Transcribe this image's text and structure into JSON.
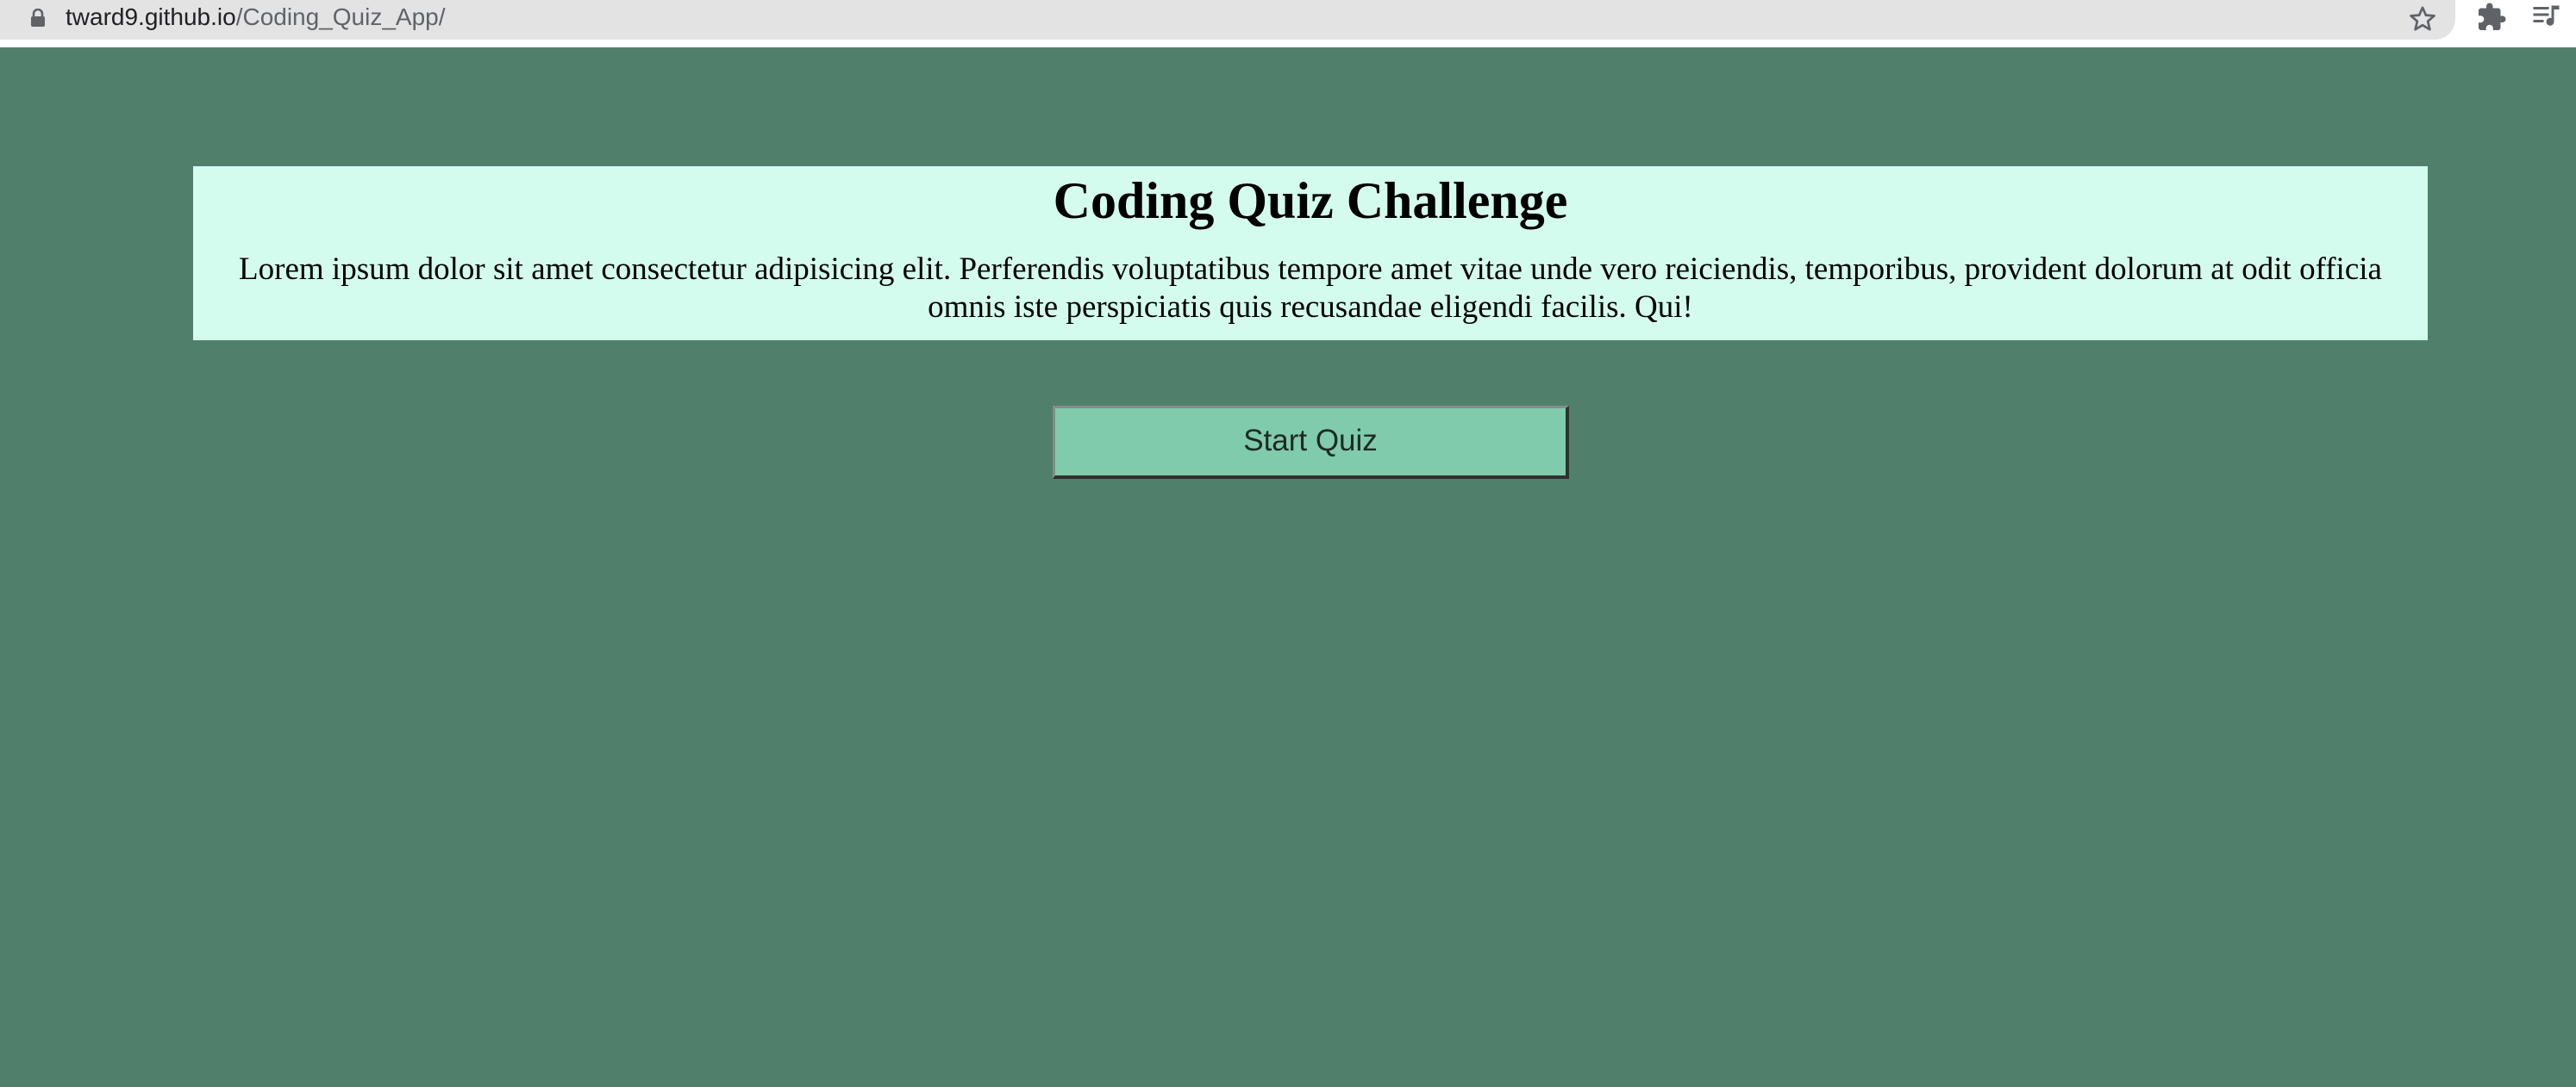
{
  "browser": {
    "url_host": "tward9.github.io",
    "url_path": "/Coding_Quiz_App/",
    "icons": [
      "lock-icon",
      "star-icon",
      "extensions-puzzle-icon",
      "media-control-icon"
    ]
  },
  "intro": {
    "title": "Coding Quiz Challenge",
    "description": "Lorem ipsum dolor sit amet consectetur adipisicing elit. Perferendis voluptatibus tempore amet vitae unde vero reiciendis, temporibus, provident dolorum at odit officia omnis iste perspiciatis quis recusandae eligendi facilis. Qui!"
  },
  "actions": {
    "start_label": "Start Quiz"
  },
  "colors": {
    "page_background": "#50806c",
    "intro_background": "#d4fcee",
    "button_background": "#7fcbac"
  }
}
